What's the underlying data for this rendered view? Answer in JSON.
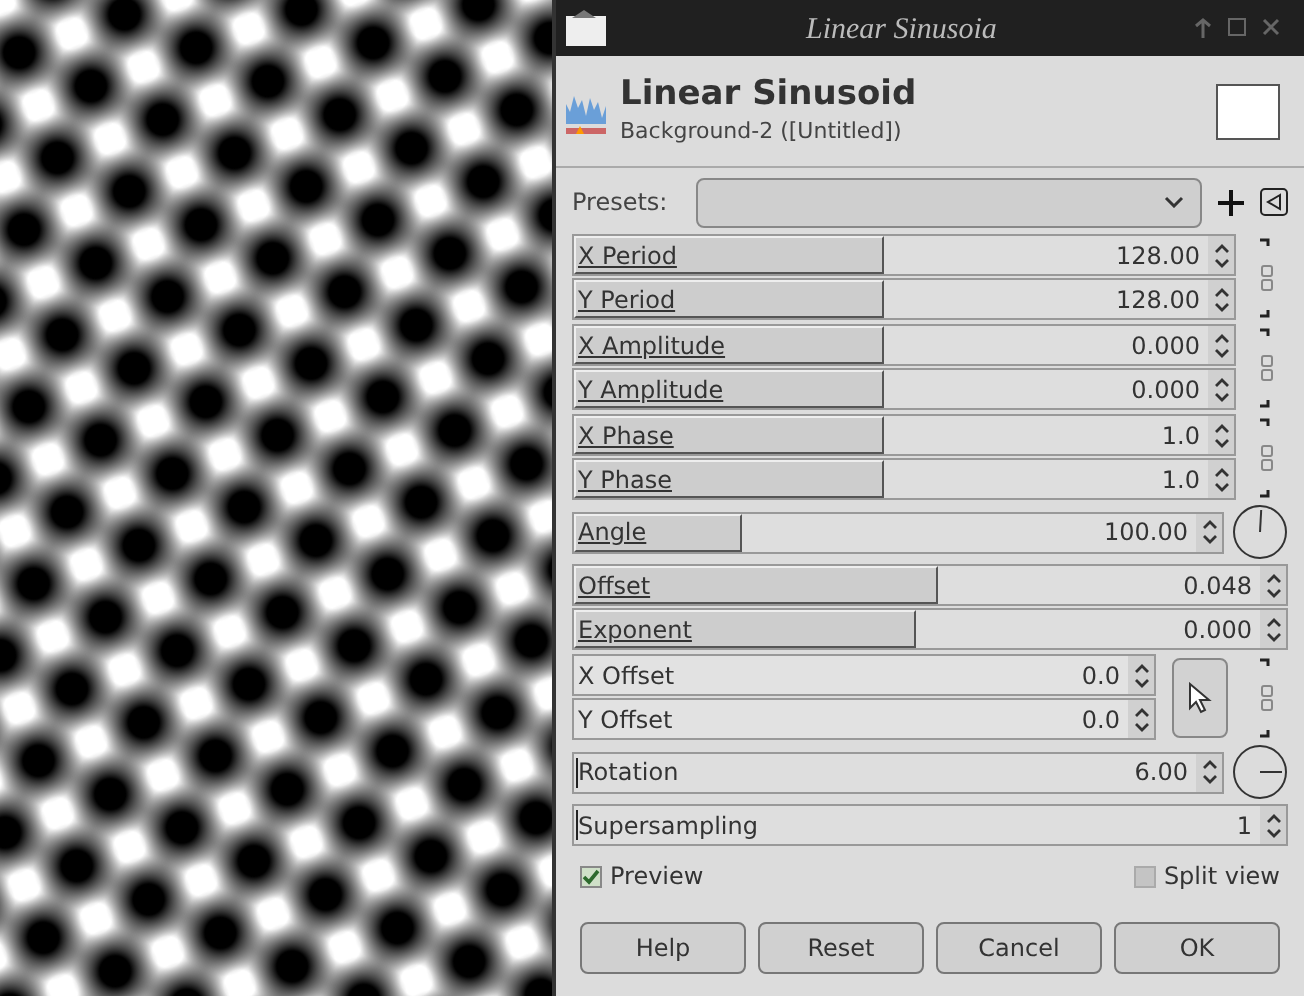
{
  "window": {
    "title": "Linear Sinusoia"
  },
  "header": {
    "title": "Linear Sinusoid",
    "subtitle": "Background-2 ([Untitled])"
  },
  "presets": {
    "label": "Presets:"
  },
  "groups": [
    {
      "chained": true,
      "params": [
        {
          "kind": "slider",
          "label": "X Period",
          "value": "128.00",
          "level": 0.47
        },
        {
          "kind": "slider",
          "label": "Y Period",
          "value": "128.00",
          "level": 0.47
        }
      ]
    },
    {
      "chained": true,
      "params": [
        {
          "kind": "slider",
          "label": "X Amplitude",
          "value": "0.000",
          "level": 0.47
        },
        {
          "kind": "slider",
          "label": "Y Amplitude",
          "value": "0.000",
          "level": 0.47
        }
      ]
    },
    {
      "chained": true,
      "params": [
        {
          "kind": "slider",
          "label": "X Phase",
          "value": "1.0",
          "level": 0.47
        },
        {
          "kind": "slider",
          "label": "Y Phase",
          "value": "1.0",
          "level": 0.47
        }
      ]
    },
    {
      "chained": false,
      "params": [
        {
          "kind": "angle",
          "label": "Angle",
          "value": "100.00",
          "level": 0.26
        }
      ]
    },
    {
      "chained": false,
      "params": [
        {
          "kind": "wide",
          "label": "Offset",
          "value": "0.048",
          "level": 0.51
        },
        {
          "kind": "wide",
          "label": "Exponent",
          "value": "0.000",
          "level": 0.48
        }
      ]
    },
    {
      "chained": true,
      "kind": "offset",
      "params": [
        {
          "kind": "spin",
          "label": "X Offset",
          "value": "0.0"
        },
        {
          "kind": "spin",
          "label": "Y Offset",
          "value": "0.0"
        }
      ]
    },
    {
      "chained": false,
      "params": [
        {
          "kind": "angle",
          "label": "Rotation",
          "value": "6.00",
          "level": 0.0
        }
      ]
    },
    {
      "chained": false,
      "params": [
        {
          "kind": "wide",
          "label": "Supersampling",
          "value": "1",
          "level": 0.0
        }
      ]
    }
  ],
  "preview": {
    "label": "Preview",
    "checked": true
  },
  "split_view": {
    "label": "Split view",
    "checked": false
  },
  "buttons": [
    "Help",
    "Reset",
    "Cancel",
    "OK"
  ]
}
